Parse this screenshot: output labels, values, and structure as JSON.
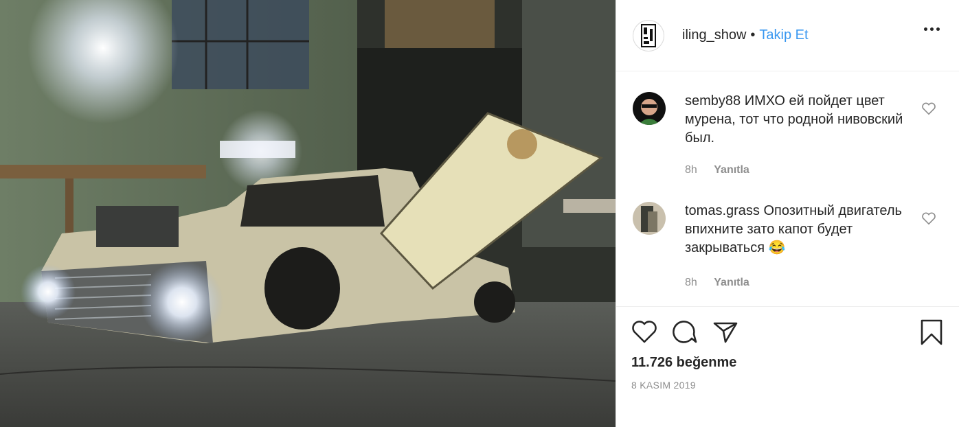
{
  "post": {
    "username": "iling_show",
    "separator": "•",
    "follow_label": "Takip Et"
  },
  "comments": [
    {
      "username": "semby88",
      "text": "ИМХО ей пойдет цвет мурена, тот что родной нивовский был.",
      "time": "8h",
      "reply_label": "Yanıtla"
    },
    {
      "username": "tomas.grass",
      "text": "Опозитный двигатель впихните зато капот будет закрываться 😂",
      "time": "8h",
      "reply_label": "Yanıtla"
    }
  ],
  "likes_label": "11.726 beğenme",
  "date_label": "8 KASIM 2019",
  "icons": {
    "like": "heart-icon",
    "comment": "comment-icon",
    "share": "share-icon",
    "save": "bookmark-icon",
    "more": "more-options-icon"
  },
  "colors": {
    "link": "#3897f0",
    "muted": "#8e8e8e",
    "text": "#262626"
  }
}
